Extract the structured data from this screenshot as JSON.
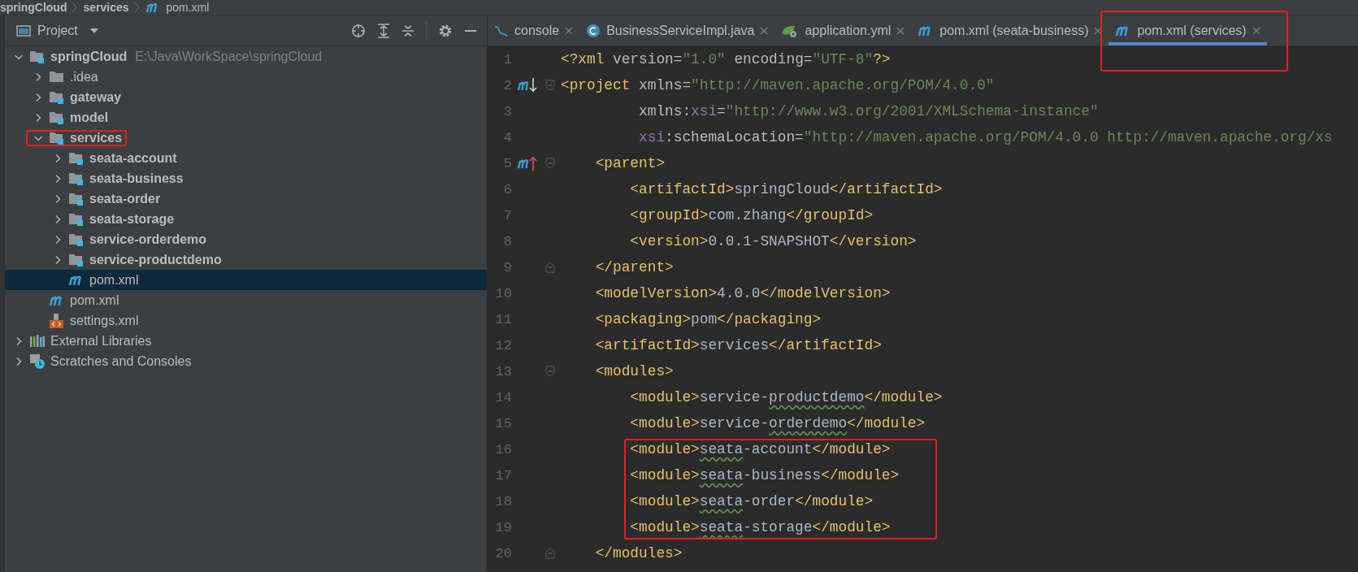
{
  "breadcrumb": [
    {
      "label": "springCloud",
      "kind": "module"
    },
    {
      "label": "services",
      "kind": "module"
    },
    {
      "label": "pom.xml",
      "kind": "maven"
    }
  ],
  "project_panel": {
    "title": "Project",
    "tree": [
      {
        "label": "springCloud",
        "kind": "module",
        "path": "E:\\Java\\WorkSpace\\springCloud",
        "expanded": true,
        "selected": false,
        "annotated": false,
        "children": [
          {
            "label": ".idea",
            "kind": "folder",
            "expanded": false,
            "selected": false,
            "annotated": false
          },
          {
            "label": "gateway",
            "kind": "module",
            "expanded": false,
            "selected": false,
            "annotated": false
          },
          {
            "label": "model",
            "kind": "module",
            "expanded": false,
            "selected": false,
            "annotated": false
          },
          {
            "label": "services",
            "kind": "module",
            "expanded": true,
            "selected": false,
            "annotated": true,
            "children": [
              {
                "label": "seata-account",
                "kind": "module",
                "expanded": false,
                "selected": false,
                "annotated": false
              },
              {
                "label": "seata-business",
                "kind": "module",
                "expanded": false,
                "selected": false,
                "annotated": false
              },
              {
                "label": "seata-order",
                "kind": "module",
                "expanded": false,
                "selected": false,
                "annotated": false
              },
              {
                "label": "seata-storage",
                "kind": "module",
                "expanded": false,
                "selected": false,
                "annotated": false
              },
              {
                "label": "service-orderdemo",
                "kind": "module",
                "expanded": false,
                "selected": false,
                "annotated": false
              },
              {
                "label": "service-productdemo",
                "kind": "module",
                "expanded": false,
                "selected": false,
                "annotated": false
              },
              {
                "label": "pom.xml",
                "kind": "maven",
                "selected": true,
                "annotated": false
              }
            ]
          },
          {
            "label": "pom.xml",
            "kind": "maven",
            "selected": false,
            "annotated": false
          },
          {
            "label": "settings.xml",
            "kind": "settings",
            "selected": false,
            "annotated": false
          }
        ]
      },
      {
        "label": "External Libraries",
        "kind": "libraries",
        "expanded": false,
        "selected": false,
        "annotated": false
      },
      {
        "label": "Scratches and Consoles",
        "kind": "scratches",
        "expanded": false,
        "selected": false,
        "annotated": false
      }
    ]
  },
  "editor": {
    "tabs": [
      {
        "label": "console",
        "kind": "console",
        "selected": false,
        "annotated": false
      },
      {
        "label": "BusinessServiceImpl.java",
        "kind": "class",
        "selected": false,
        "annotated": false
      },
      {
        "label": "application.yml",
        "kind": "leaf",
        "selected": false,
        "annotated": false
      },
      {
        "label": "pom.xml (seata-business)",
        "kind": "maven",
        "selected": false,
        "annotated": false
      },
      {
        "label": "pom.xml (services)",
        "kind": "maven",
        "selected": true,
        "annotated": true
      }
    ],
    "lines": [
      {
        "number": "1",
        "segments": [
          {
            "kind": "tag",
            "text": "<?xml"
          },
          {
            "kind": "attr",
            "text": " version="
          },
          {
            "kind": "str",
            "text": "\"1.0\""
          },
          {
            "kind": "attr",
            "text": " encoding="
          },
          {
            "kind": "str",
            "text": "\"UTF-8\""
          },
          {
            "kind": "tag",
            "text": "?>"
          }
        ]
      },
      {
        "number": "2",
        "marker": {
          "kind": "down"
        },
        "fold_start": true,
        "segments": [
          {
            "kind": "tag",
            "text": "<project"
          },
          {
            "kind": "attr",
            "text": " xmlns="
          },
          {
            "kind": "str",
            "text": "\"http://maven.apache.org/POM/4.0.0\""
          }
        ]
      },
      {
        "number": "3",
        "segments": [
          {
            "kind": "attr",
            "text": "         xmlns:"
          },
          {
            "kind": "ns",
            "text": "xsi"
          },
          {
            "kind": "attr",
            "text": "="
          },
          {
            "kind": "str",
            "text": "\"http://www.w3.org/2001/XMLSchema-instance\""
          }
        ]
      },
      {
        "number": "4",
        "segments": [
          {
            "kind": "ns",
            "text": "         xsi"
          },
          {
            "kind": "attr",
            "text": ":schemaLocation="
          },
          {
            "kind": "str",
            "text": "\"http://maven.apache.org/POM/4.0.0 http://maven.apache.org/xs"
          }
        ]
      },
      {
        "number": "5",
        "marker": {
          "kind": "up"
        },
        "fold_start": true,
        "segments": [
          {
            "kind": "tag",
            "text": "    <parent>"
          }
        ]
      },
      {
        "number": "6",
        "segments": [
          {
            "kind": "tag",
            "text": "        <artifactId>"
          },
          {
            "kind": "text",
            "text": "springCloud"
          },
          {
            "kind": "tag",
            "text": "</artifactId>"
          }
        ]
      },
      {
        "number": "7",
        "segments": [
          {
            "kind": "tag",
            "text": "        <groupId>"
          },
          {
            "kind": "text",
            "text": "com.zhang"
          },
          {
            "kind": "tag",
            "text": "</groupId>"
          }
        ]
      },
      {
        "number": "8",
        "segments": [
          {
            "kind": "tag",
            "text": "        <version>"
          },
          {
            "kind": "text",
            "text": "0.0.1-SNAPSHOT"
          },
          {
            "kind": "tag",
            "text": "</version>"
          }
        ]
      },
      {
        "number": "9",
        "fold_end": true,
        "segments": [
          {
            "kind": "tag",
            "text": "    </parent>"
          }
        ]
      },
      {
        "number": "10",
        "segments": [
          {
            "kind": "tag",
            "text": "    <modelVersion>"
          },
          {
            "kind": "text",
            "text": "4.0.0"
          },
          {
            "kind": "tag",
            "text": "</modelVersion>"
          }
        ]
      },
      {
        "number": "11",
        "segments": [
          {
            "kind": "tag",
            "text": "    <packaging>"
          },
          {
            "kind": "text",
            "text": "pom"
          },
          {
            "kind": "tag",
            "text": "</packaging>"
          }
        ]
      },
      {
        "number": "12",
        "segments": [
          {
            "kind": "tag",
            "text": "    <artifactId>"
          },
          {
            "kind": "text",
            "text": "services"
          },
          {
            "kind": "tag",
            "text": "</artifactId>"
          }
        ]
      },
      {
        "number": "13",
        "fold_start": true,
        "segments": [
          {
            "kind": "tag",
            "text": "    <modules>"
          }
        ]
      },
      {
        "number": "14",
        "segments": [
          {
            "kind": "tag",
            "text": "        <module>"
          },
          {
            "kind": "text",
            "text": "service-"
          },
          {
            "kind": "text",
            "text": "productdemo",
            "typo": true
          },
          {
            "kind": "tag",
            "text": "</module>"
          }
        ]
      },
      {
        "number": "15",
        "segments": [
          {
            "kind": "tag",
            "text": "        <module>"
          },
          {
            "kind": "text",
            "text": "service-"
          },
          {
            "kind": "text",
            "text": "orderdemo",
            "typo": true
          },
          {
            "kind": "tag",
            "text": "</module>"
          }
        ]
      },
      {
        "number": "16",
        "boxed": true,
        "segments": [
          {
            "kind": "tag",
            "text": "        <module>"
          },
          {
            "kind": "text",
            "text": "seata",
            "typo": true
          },
          {
            "kind": "text",
            "text": "-account"
          },
          {
            "kind": "tag",
            "text": "</module>"
          }
        ]
      },
      {
        "number": "17",
        "boxed": true,
        "segments": [
          {
            "kind": "tag",
            "text": "        <module>"
          },
          {
            "kind": "text",
            "text": "seata",
            "typo": true
          },
          {
            "kind": "text",
            "text": "-business"
          },
          {
            "kind": "tag",
            "text": "</module>"
          }
        ]
      },
      {
        "number": "18",
        "boxed": true,
        "segments": [
          {
            "kind": "tag",
            "text": "        <module>"
          },
          {
            "kind": "text",
            "text": "seata",
            "typo": true
          },
          {
            "kind": "text",
            "text": "-order"
          },
          {
            "kind": "tag",
            "text": "</module>"
          }
        ]
      },
      {
        "number": "19",
        "boxed": true,
        "segments": [
          {
            "kind": "tag",
            "text": "        <module>"
          },
          {
            "kind": "text",
            "text": "seata",
            "typo": true
          },
          {
            "kind": "text",
            "text": "-storage"
          },
          {
            "kind": "tag",
            "text": "</module>"
          }
        ]
      },
      {
        "number": "20",
        "fold_end": true,
        "segments": [
          {
            "kind": "tag",
            "text": "    </modules>"
          }
        ]
      }
    ]
  }
}
